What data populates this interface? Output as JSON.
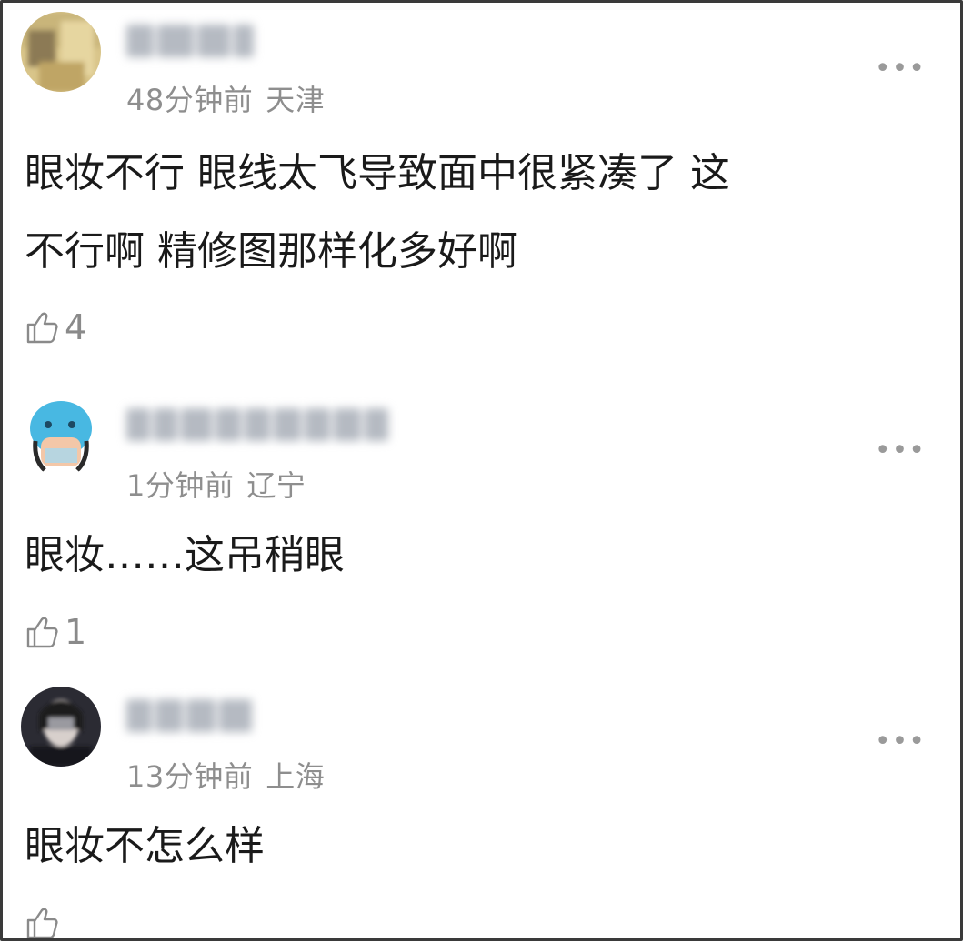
{
  "comments": [
    {
      "time": "48分钟前",
      "location": "天津",
      "text_lines": [
        "眼妆不行 眼线太飞导致面中很紧凑了 这",
        "不行啊 精修图那样化多好啊"
      ],
      "likes": "4",
      "avatar_icon": "avatar-blurred-yellow"
    },
    {
      "time": "1分钟前",
      "location": "辽宁",
      "text_lines": [
        "眼妆……这吊稍眼"
      ],
      "likes": "1",
      "avatar_icon": "avatar-cartoon-blue-hat"
    },
    {
      "time": "13分钟前",
      "location": "上海",
      "text_lines": [
        "眼妆不怎么样"
      ],
      "likes": "",
      "avatar_icon": "avatar-dark-portrait"
    }
  ],
  "more_label": "•••",
  "icons": {
    "like": "thumbs-up-icon",
    "more": "more-dots-icon"
  },
  "colors": {
    "meta_gray": "#8e8e8e",
    "text": "#1a1a1a",
    "border": "#3a3a3a"
  }
}
